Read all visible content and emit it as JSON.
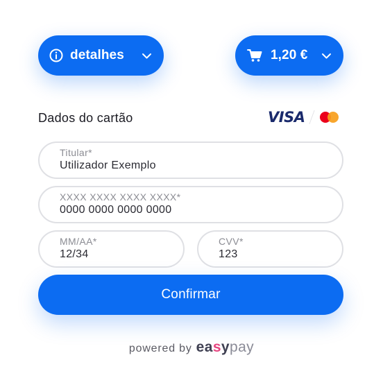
{
  "header": {
    "details_label": "detalhes",
    "details_icon": "info-circle-icon",
    "cart_label": "1,20 €",
    "cart_icon": "cart-icon",
    "dropdown_icon": "chevron-down-icon"
  },
  "card_section": {
    "title": "Dados do cartão",
    "brands": {
      "visa": "VISA",
      "mastercard_icon": "mastercard-logo"
    }
  },
  "fields": {
    "holder": {
      "label": "Titular*",
      "value": "Utilizador Exemplo"
    },
    "number": {
      "label": "XXXX XXXX XXXX XXXX*",
      "value": "0000 0000 0000 0000"
    },
    "expiry": {
      "label": "MM/AA*",
      "value": "12/34"
    },
    "cvv": {
      "label": "CVV*",
      "value": "123"
    }
  },
  "actions": {
    "confirm_label": "Confirmar"
  },
  "footer": {
    "powered_by": "powered by",
    "logo_parts": [
      "ea",
      "s",
      "y",
      "pay"
    ]
  },
  "colors": {
    "accent": "#0c6cf2",
    "border": "#dfe0e4",
    "label": "#8b8c93",
    "visa": "#1a2a6c",
    "mastercard_red": "#eb001b",
    "mastercard_yellow": "#f79e1b",
    "easypay_pink": "#e6447f"
  }
}
